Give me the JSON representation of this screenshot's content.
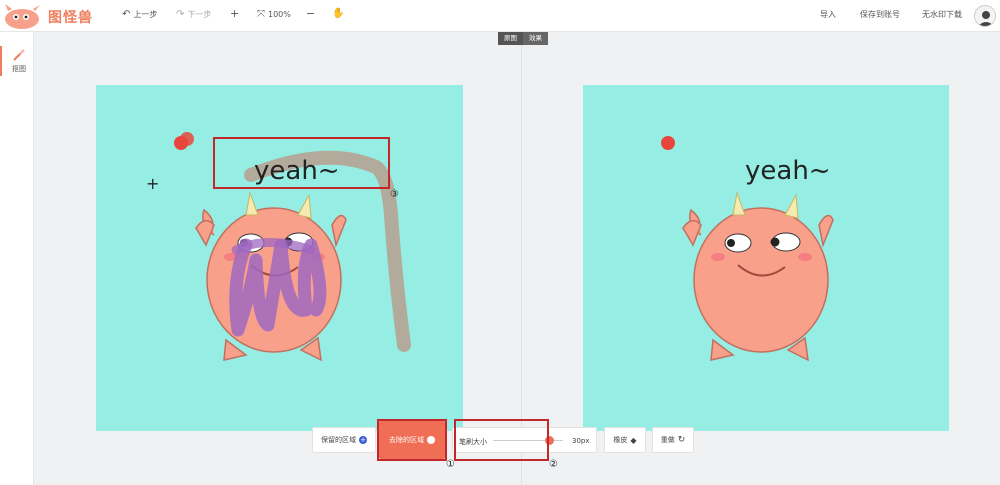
{
  "app": {
    "logo_text": "图怪兽"
  },
  "toolbar": {
    "undo_label": "上一步",
    "redo_label": "下一步",
    "zoom_in_label": "+",
    "zoom_value": "100%",
    "zoom_out_label": "−",
    "import_label": "导入",
    "save_label": "保存到账号",
    "download_label": "无水印下载"
  },
  "sidebar": {
    "items": [
      {
        "label": "抠图",
        "icon": "brush-icon"
      }
    ]
  },
  "view_tabs": [
    {
      "label": "原图"
    },
    {
      "label": "效果"
    }
  ],
  "canvas": {
    "text": "yeah~",
    "background": "#96ede4"
  },
  "bottom": {
    "keep_area_label": "保留的区域",
    "keep_area_icon": "+",
    "remove_area_label": "去除的区域",
    "brush_size_label": "笔刷大小",
    "brush_size_value": 0.8,
    "brush_size_text": "30px",
    "eraser_label": "橡皮",
    "redo_label": "重做"
  },
  "annotations": {
    "m1": "①",
    "m2": "②",
    "m3": "③"
  },
  "colors": {
    "accent": "#ef6e55",
    "highlight_box": "#c2282a"
  }
}
